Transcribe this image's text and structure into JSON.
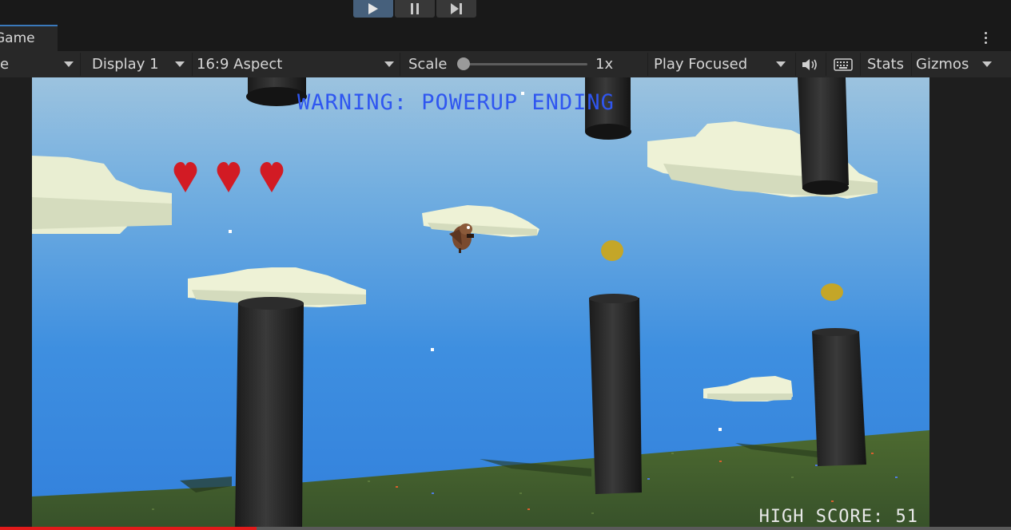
{
  "play_controls": {
    "play_icon": "play-icon",
    "pause_icon": "pause-icon",
    "step_icon": "step-icon",
    "active_color": "#46607c"
  },
  "tab": {
    "label": "Game"
  },
  "toolbar": {
    "view_dropdown": "e",
    "display": "Display 1",
    "aspect": "16:9 Aspect",
    "scale_label": "Scale",
    "scale_value": "1x",
    "play_mode": "Play Focused",
    "audio_icon": "speaker-icon",
    "keyboard_icon": "keyboard-icon",
    "stats_label": "Stats",
    "gizmos_label": "Gizmos"
  },
  "game": {
    "warning": "WARNING: POWERUP ENDING",
    "lives": 3,
    "heart_color": "#d21b24",
    "high_score": "HIGH SCORE: 51",
    "warning_color": "#2f56f0"
  },
  "video_progress": {
    "fraction": 0.254,
    "color": "#e11a1a"
  }
}
